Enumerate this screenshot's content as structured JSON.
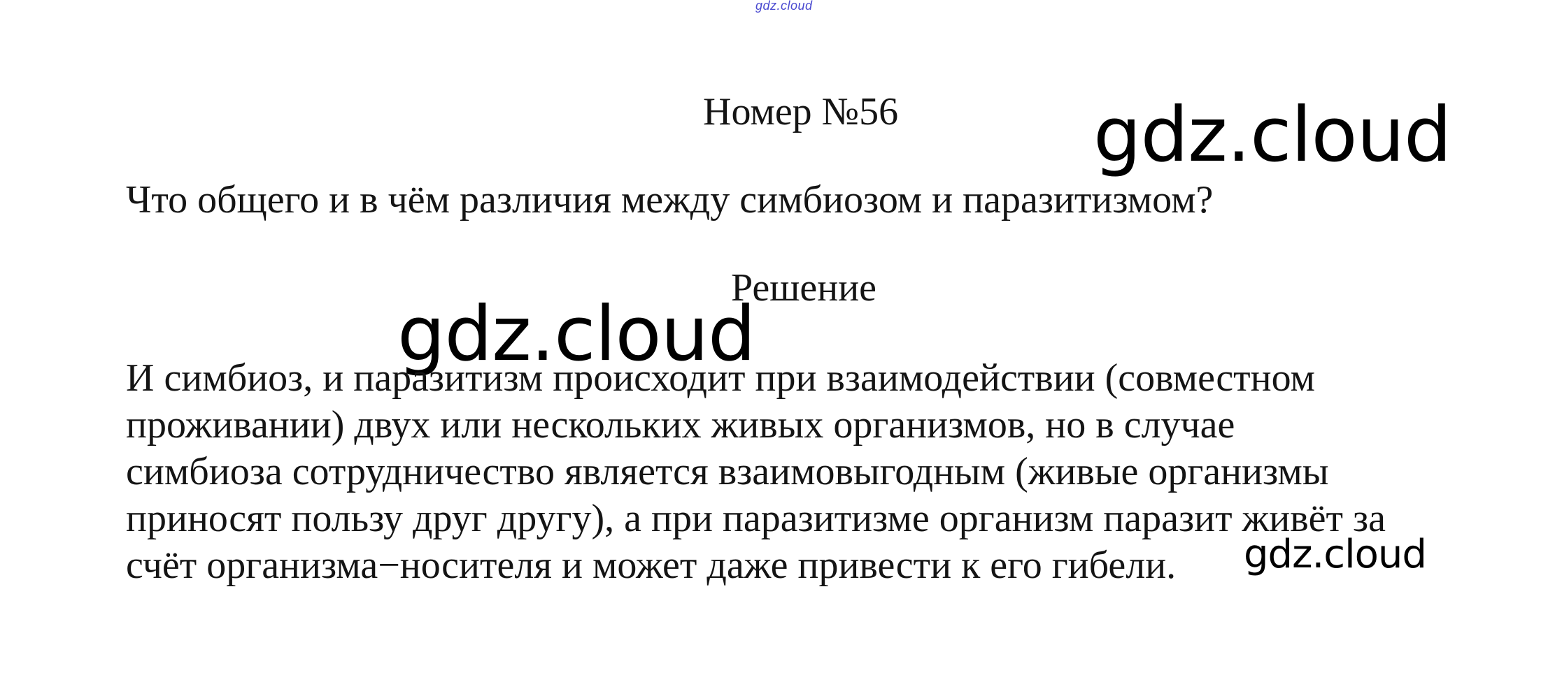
{
  "top_watermark": "gdz.cloud",
  "title": "Номер №56",
  "question": "Что общего и в чём различия между симбиозом и паразитизмом?",
  "solution_heading": "Решение",
  "answer_lines": [
    "И симбиоз, и паразитизм происходит при взаимодействии (совместном",
    "проживании) двух или нескольких живых организмов, но в случае",
    "симбиоза сотрудничество является взаимовыгодным (живые организмы",
    "приносят пользу друг другу), а при паразитизме организм паразит живёт за",
    "счёт организма−носителя и может даже привести к его гибели."
  ],
  "watermarks": {
    "large_right": "gdz.cloud",
    "large_left": "gdz.cloud",
    "small": "gdz.cloud"
  },
  "colors": {
    "top_watermark": "#4a4ad0",
    "text": "#141414",
    "watermark": "#000000"
  }
}
